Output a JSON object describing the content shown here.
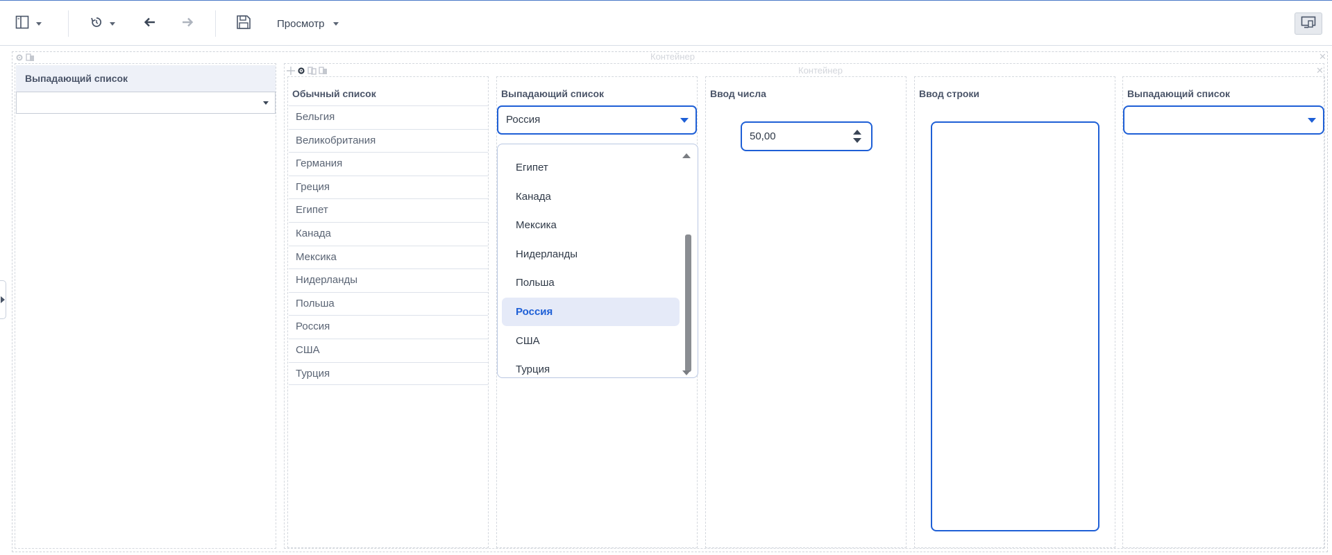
{
  "toolbar": {
    "view_label": "Просмотр"
  },
  "containers": {
    "outer_caption": "Контейнер",
    "inner_caption": "Контейнер"
  },
  "left_panel": {
    "title": "Выпадающий список",
    "value": ""
  },
  "plain_list": {
    "title": "Обычный список",
    "items": [
      "Бельгия",
      "Великобритания",
      "Германия",
      "Греция",
      "Египет",
      "Канада",
      "Мексика",
      "Нидерланды",
      "Польша",
      "Россия",
      "США",
      "Турция"
    ]
  },
  "dropdown": {
    "title": "Выпадающий список",
    "value": "Россия",
    "options": [
      "Египет",
      "Канада",
      "Мексика",
      "Нидерланды",
      "Польша",
      "Россия",
      "США",
      "Турция"
    ],
    "selected": "Россия"
  },
  "number_input": {
    "title": "Ввод числа",
    "value": "50,00"
  },
  "string_input": {
    "title": "Ввод строки",
    "value": ""
  },
  "dropdown2": {
    "title": "Выпадающий список",
    "value": ""
  },
  "colors": {
    "accent": "#1e5fd6",
    "selected_bg": "#e5eaf8",
    "header_bg": "#eef1f8"
  }
}
